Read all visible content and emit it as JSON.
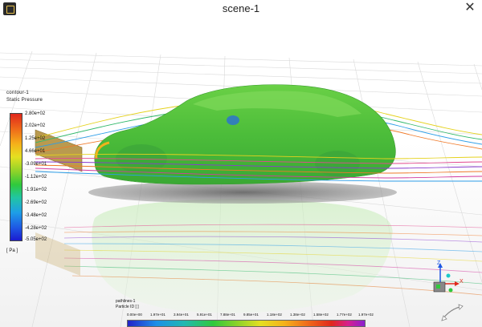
{
  "window": {
    "title": "scene-1",
    "close_glyph": "✕"
  },
  "legend": {
    "title_line1": "contour-1",
    "title_line2": "Static Pressure",
    "ticks": [
      "2.80e+02",
      "2.02e+02",
      "1.25e+02",
      "4.66e+01",
      "-3.09e+01",
      "-1.12e+02",
      "-1.91e+02",
      "-2.69e+02",
      "-3.48e+02",
      "-4.28e+02",
      "-5.05e+02"
    ],
    "units": "[ Pa ]"
  },
  "particle_legend": {
    "title_line1": "pathlines-1",
    "title_line2": "Particle ID [ ]",
    "ticks": [
      "0.00e+00",
      "1.97e+01",
      "3.94e+01",
      "5.91e+01",
      "7.88e+01",
      "9.85e+01",
      "1.18e+02",
      "1.38e+02",
      "1.58e+02",
      "1.77e+02",
      "1.97e+02"
    ]
  },
  "colors": {
    "car_green": "#52c23f",
    "floor": "#ffffff",
    "shadow": "#7a7a7a"
  },
  "icons": {
    "app": "ansys-app-icon",
    "close": "close-icon",
    "triad": "axis-triad-icon",
    "rotate": "rotate-arrow-icon"
  },
  "triad": {
    "z": "Z",
    "x": "X"
  }
}
